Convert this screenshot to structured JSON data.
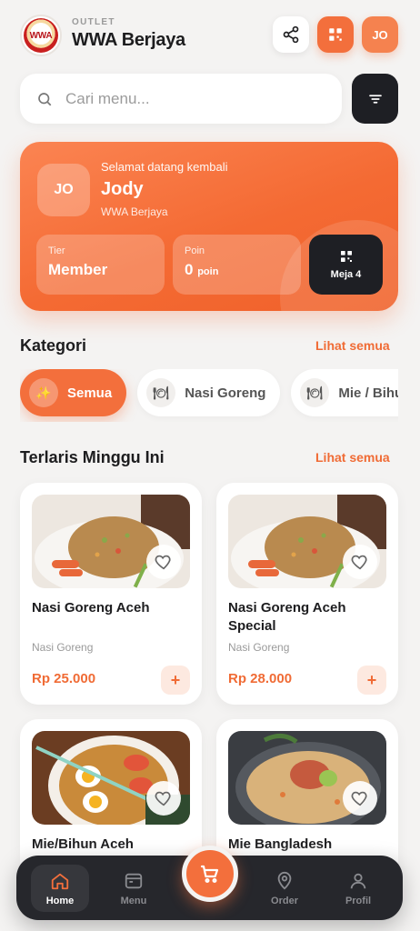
{
  "header": {
    "logo_text": "WWA",
    "outlet_label": "OUTLET",
    "outlet_name": "WWA Berjaya",
    "user_initials": "JO",
    "accent_color": "#f36f3c"
  },
  "search": {
    "placeholder": "Cari menu..."
  },
  "welcome": {
    "avatar_initials": "JO",
    "greeting": "Selamat datang kembali",
    "name": "Jody",
    "outlet": "WWA Berjaya",
    "tier_label": "Tier",
    "tier_value": "Member",
    "points_label": "Poin",
    "points_value": "0",
    "points_unit": "poin",
    "table_label": "Meja 4"
  },
  "categories": {
    "title": "Kategori",
    "see_all": "Lihat semua",
    "items": [
      {
        "label": "Semua",
        "icon": "sparkle-icon",
        "active": true
      },
      {
        "label": "Nasi Goreng",
        "icon": "plate-icon",
        "active": false
      },
      {
        "label": "Mie / Bihun",
        "icon": "plate-icon",
        "active": false
      }
    ]
  },
  "bestsellers": {
    "title": "Terlaris Minggu Ini",
    "see_all": "Lihat semua",
    "products": [
      {
        "name": "Nasi Goreng Aceh",
        "category": "Nasi Goreng",
        "price": "Rp 25.000"
      },
      {
        "name": "Nasi Goreng Aceh Special",
        "category": "Nasi Goreng",
        "price": "Rp 28.000"
      },
      {
        "name": "Mie/Bihun Aceh",
        "category": "",
        "price": ""
      },
      {
        "name": "Mie Bangladesh",
        "category": "",
        "price": ""
      }
    ]
  },
  "bottom_nav": {
    "items": [
      {
        "label": "Home",
        "icon": "home-icon",
        "active": true
      },
      {
        "label": "Menu",
        "icon": "menu-icon",
        "active": false
      },
      {
        "label": "Order",
        "icon": "location-pin-icon",
        "active": false
      },
      {
        "label": "Profil",
        "icon": "user-icon",
        "active": false
      }
    ],
    "cart_icon": "cart-icon"
  }
}
